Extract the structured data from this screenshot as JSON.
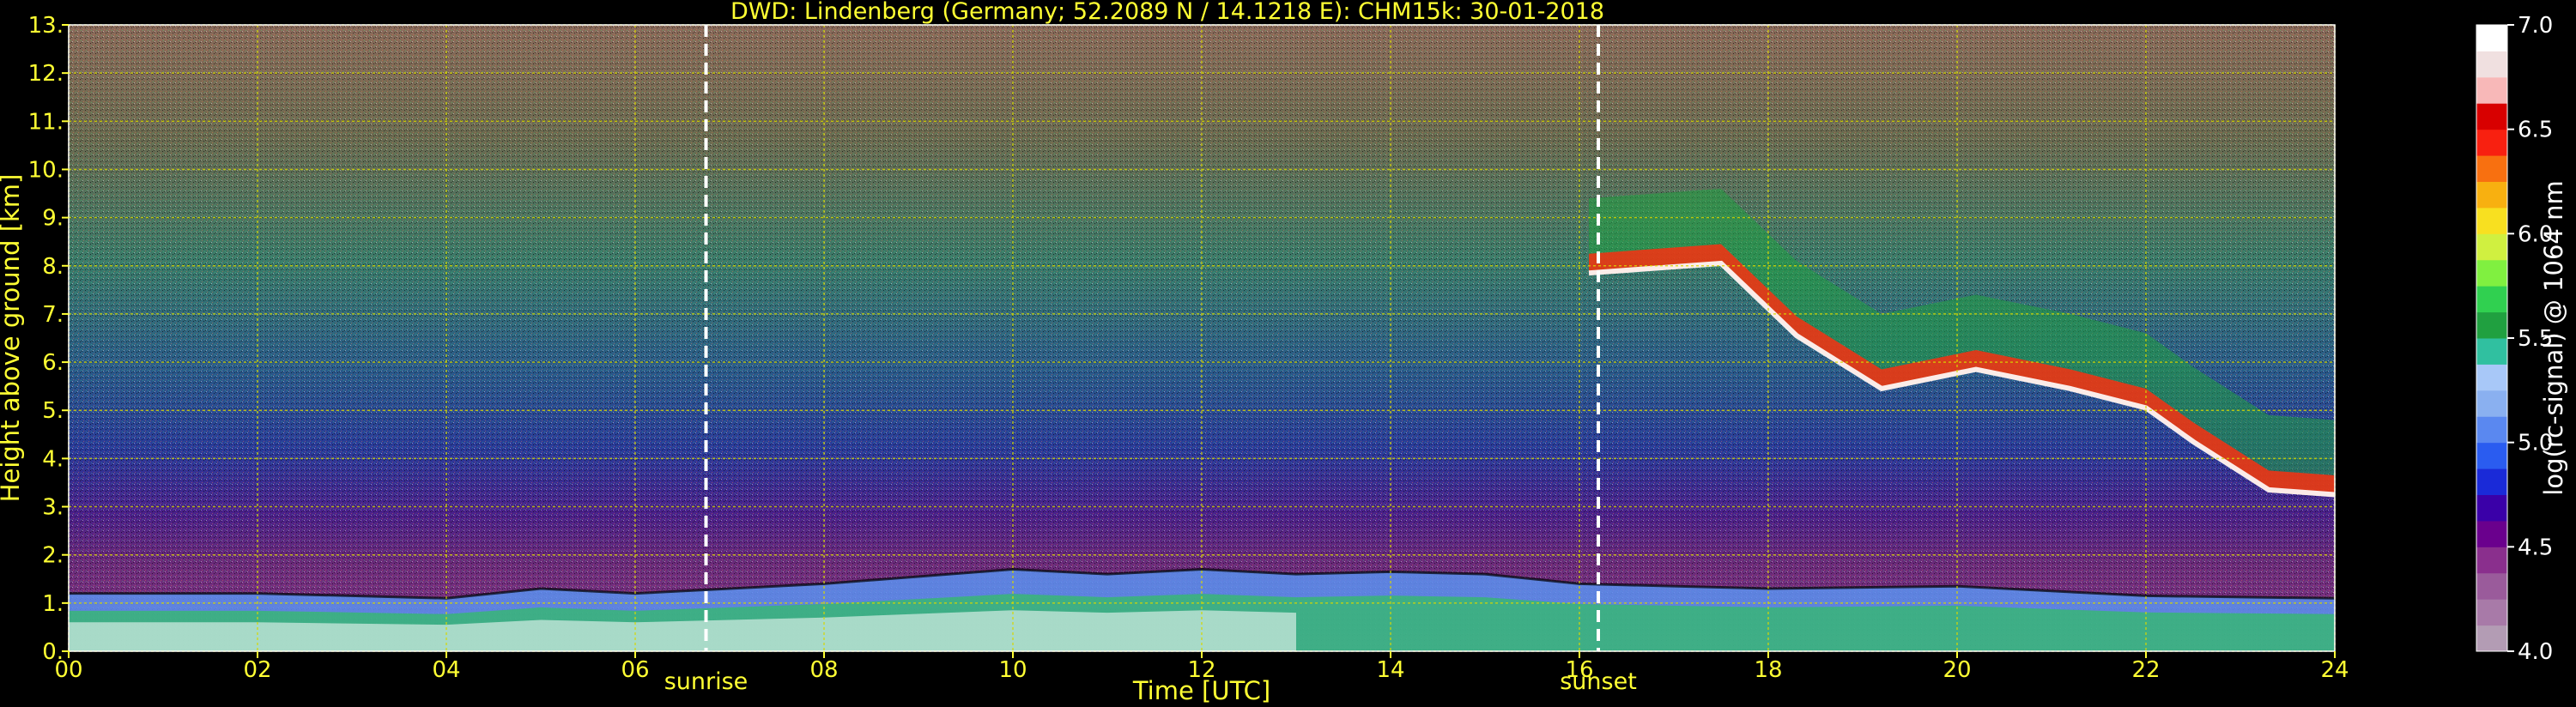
{
  "chart_data": {
    "type": "heatmap",
    "title": "DWD: Lindenberg (Germany; 52.2089 N / 14.1218 E):    CHM15k: 30-01-2018",
    "xlabel": "Time [UTC]",
    "ylabel": "Height above ground [km]",
    "xlim": [
      0,
      24
    ],
    "ylim": [
      0,
      13
    ],
    "x_ticks": [
      0,
      2,
      4,
      6,
      8,
      10,
      12,
      14,
      16,
      18,
      20,
      22,
      24
    ],
    "x_tick_labels": [
      "00",
      "02",
      "04",
      "06",
      "08",
      "10",
      "12",
      "14",
      "16",
      "18",
      "20",
      "22",
      "24"
    ],
    "y_ticks": [
      0,
      1,
      2,
      3,
      4,
      5,
      6,
      7,
      8,
      9,
      10,
      11,
      12,
      13
    ],
    "y_tick_labels": [
      "0.",
      "1.",
      "2.",
      "3.",
      "4.",
      "5.",
      "6.",
      "7.",
      "8.",
      "9.",
      "10.",
      "11.",
      "12.",
      "13."
    ],
    "grid": true,
    "colorbar": {
      "label": "log(rc-signal) @ 1064 nm",
      "range": [
        4.0,
        7.0
      ],
      "ticks": [
        4.0,
        4.5,
        5.0,
        5.5,
        6.0,
        6.5,
        7.0
      ],
      "tick_labels": [
        "4.0",
        "4.5",
        "5.0",
        "5.5",
        "6.0",
        "6.5",
        "7.0"
      ],
      "colors": [
        "#b39cb4",
        "#a87aa8",
        "#9a5b9b",
        "#8a2f8d",
        "#6a008d",
        "#3a00a8",
        "#1a2ad8",
        "#2a5cf0",
        "#5a88f0",
        "#8ab0f0",
        "#a8c8f8",
        "#30c0a0",
        "#20a040",
        "#30d050",
        "#80f040",
        "#d0f040",
        "#f8e020",
        "#f8b010",
        "#f87010",
        "#f82010",
        "#d80000",
        "#f8b8b8",
        "#f0e0e0",
        "#ffffff"
      ]
    },
    "annotations": [
      {
        "text": "sunrise",
        "x": 6.75
      },
      {
        "text": "sunset",
        "x": 16.2
      }
    ],
    "features": {
      "boundary_layer_top_km": [
        [
          0,
          1.2
        ],
        [
          2,
          1.2
        ],
        [
          4,
          1.1
        ],
        [
          5,
          1.3
        ],
        [
          6,
          1.2
        ],
        [
          8,
          1.4
        ],
        [
          10,
          1.7
        ],
        [
          11,
          1.6
        ],
        [
          12,
          1.7
        ],
        [
          13,
          1.6
        ],
        [
          14,
          1.65
        ],
        [
          15,
          1.6
        ],
        [
          16,
          1.4
        ],
        [
          18,
          1.3
        ],
        [
          20,
          1.35
        ],
        [
          22,
          1.15
        ],
        [
          24,
          1.1
        ]
      ],
      "cirrus_base_km": [
        [
          16.1,
          7.8
        ],
        [
          17.5,
          8.0
        ],
        [
          18.3,
          6.5
        ],
        [
          19.2,
          5.4
        ],
        [
          20.2,
          5.8
        ],
        [
          21.2,
          5.4
        ],
        [
          22.0,
          5.0
        ],
        [
          22.5,
          4.3
        ],
        [
          23.3,
          3.3
        ],
        [
          24,
          3.2
        ]
      ]
    },
    "background_color": "#000000",
    "text_color": "#ffff33"
  }
}
